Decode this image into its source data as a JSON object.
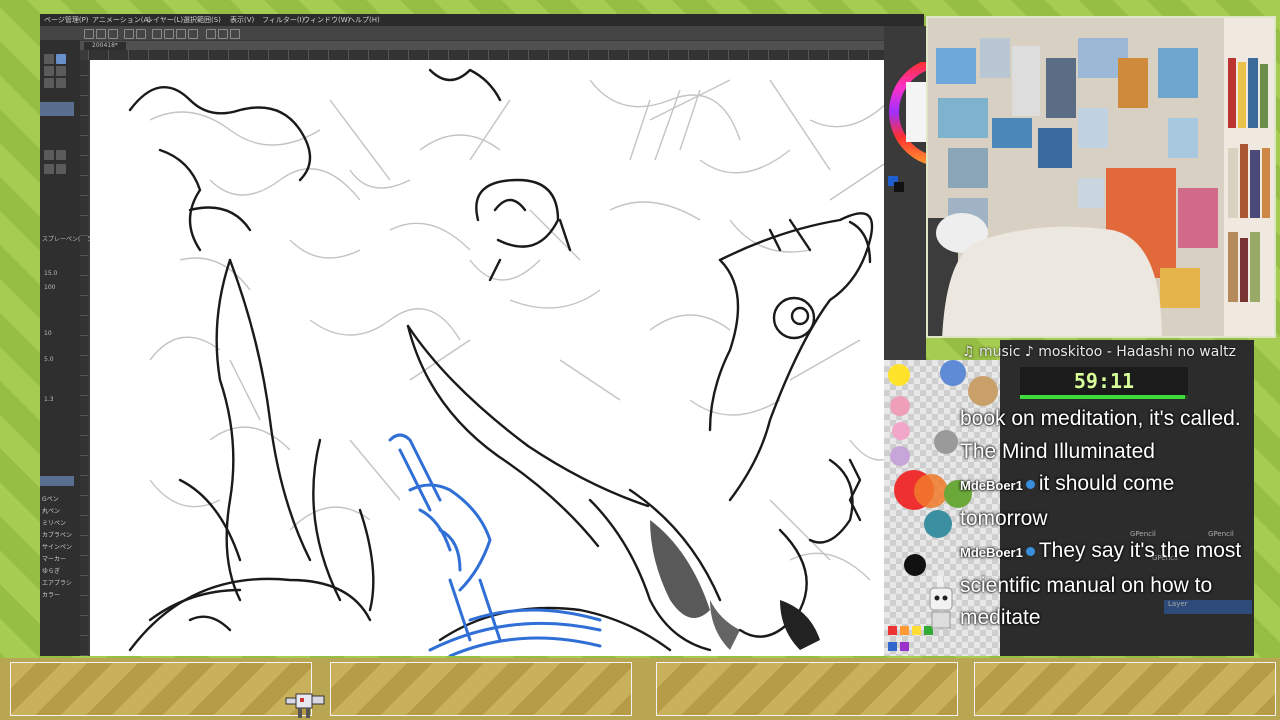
{
  "app": {
    "menu": [
      "ページ管理(P)",
      "アニメーション(A)",
      "レイヤー(L)",
      "選択範囲(S)",
      "表示(V)",
      "フィルター(I)",
      "ウィンドウ(W)",
      "ヘルプ(H)"
    ],
    "document_tab": "200418*",
    "tool_property": {
      "panel_label": "スプレーペン(カラー)",
      "brush_size": "15.0",
      "opacity": "100",
      "value_a": "10",
      "value_b": "5.0",
      "value_c": "1.3"
    },
    "subtools": [
      "Gペン",
      "丸ペン",
      "ミリペン",
      "カブラペン",
      "サインペン",
      "マーカー",
      "ゆらぎ",
      "エアブラシ",
      "カラー"
    ]
  },
  "stream": {
    "music": "♫ music ♪ moskitoo - Hadashi no waltz",
    "timer": "59:11",
    "timer_progress": 0.98,
    "chat": [
      {
        "user": "",
        "text": "book on meditation, it's called. The Mind Illuminated"
      },
      {
        "user": "MdeBoer1",
        "text": "it should come tomorrow"
      },
      {
        "user": "MdeBoer1",
        "text": "They say it's the most scientific manual on how to meditate"
      }
    ]
  },
  "layers": {
    "items": [
      "GPencil",
      "GPencil",
      "GPencil",
      "Layer"
    ]
  },
  "colors": {
    "ink": "#1a1a1a",
    "pencil_grey": "#9a9a9a",
    "blue_sketch": "#2f6fd6",
    "overlay_green": "#9cc24a",
    "chat_badge": "#3a8fdc",
    "timer_text": "#d8ff9a"
  }
}
